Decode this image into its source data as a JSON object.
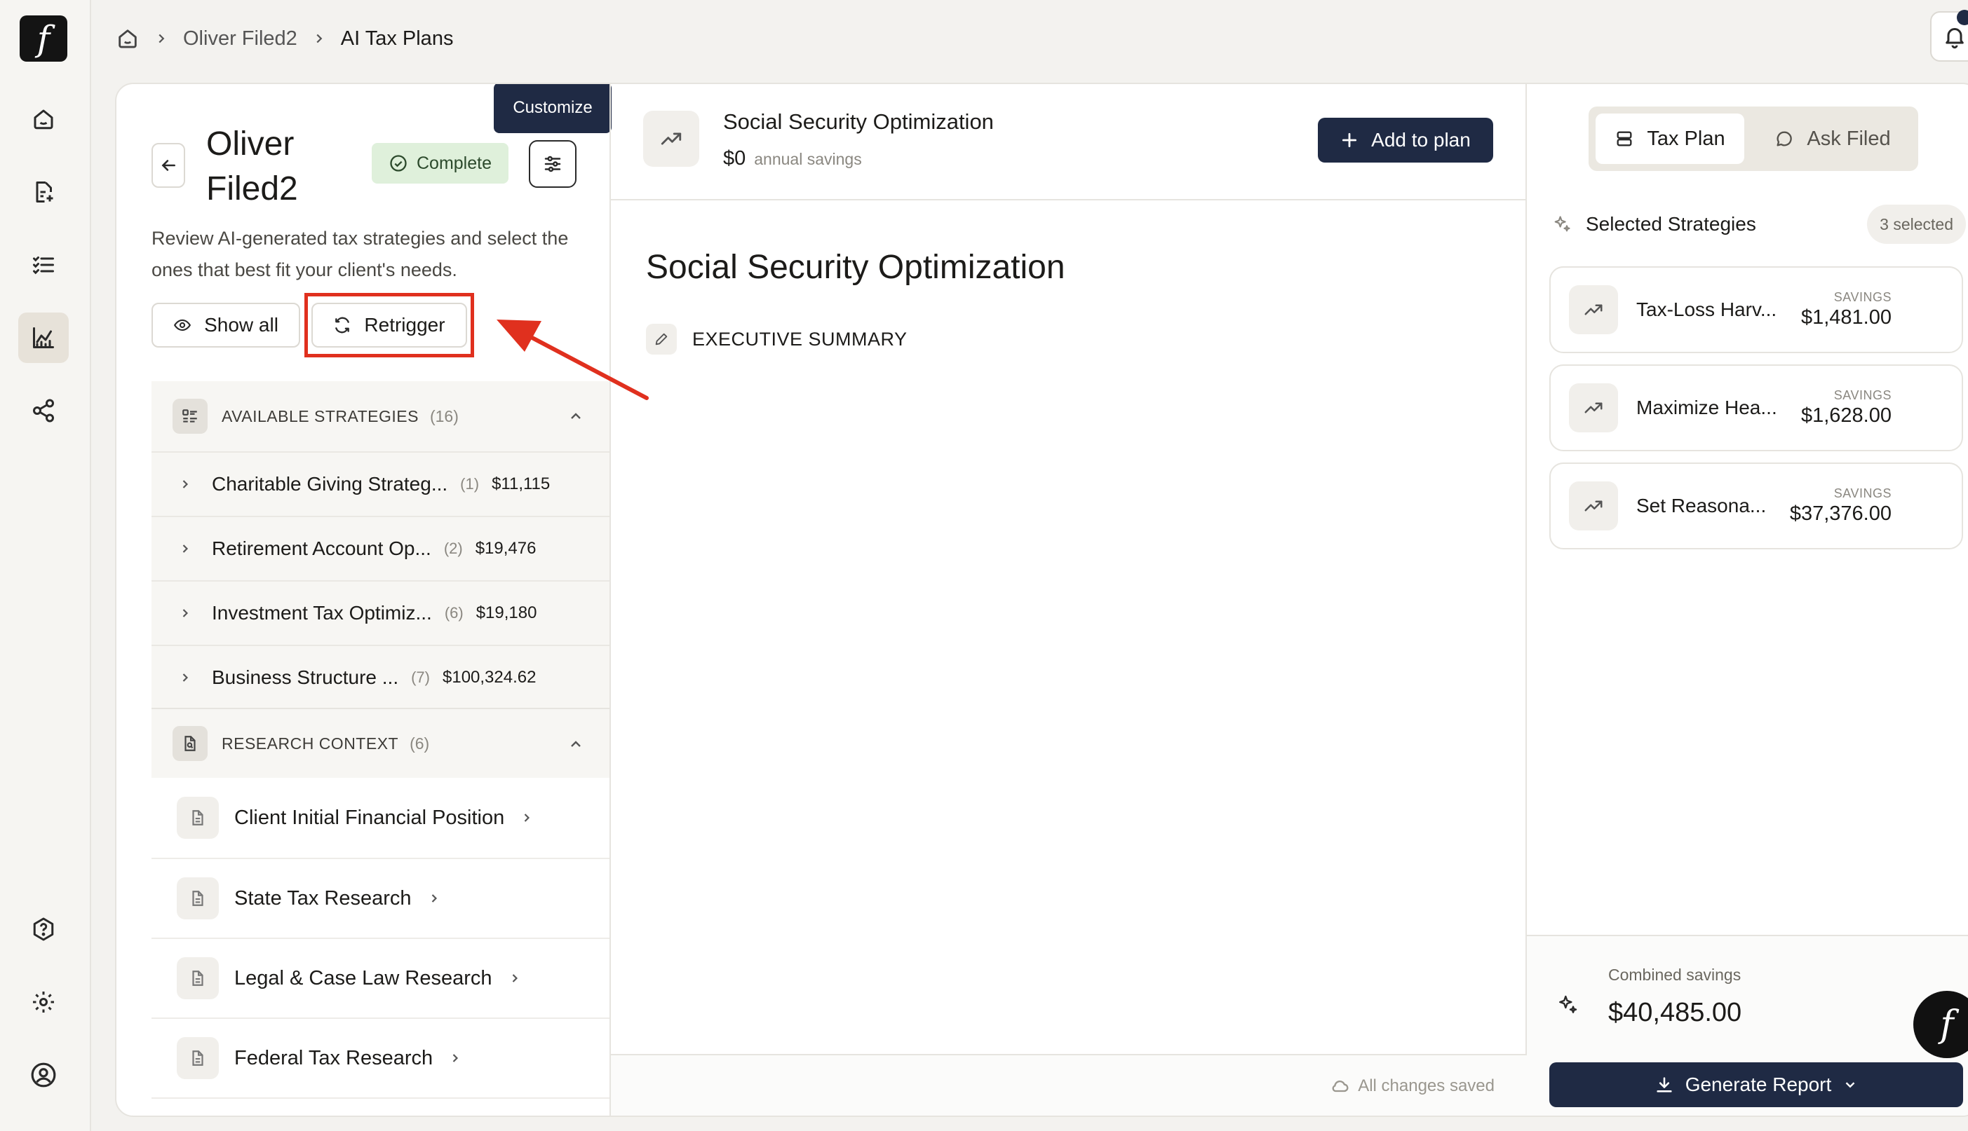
{
  "app": {
    "logo_glyph": "f",
    "nav": [
      {
        "name": "home",
        "icon": "home-icon"
      },
      {
        "name": "documents",
        "icon": "document-sparkle-icon"
      },
      {
        "name": "checklist",
        "icon": "checklist-icon"
      },
      {
        "name": "tax-plans",
        "icon": "chart-icon",
        "active": true
      },
      {
        "name": "share",
        "icon": "share-icon"
      },
      {
        "name": "help",
        "icon": "help-icon"
      },
      {
        "name": "settings",
        "icon": "gear-icon"
      },
      {
        "name": "account",
        "icon": "user-icon"
      }
    ]
  },
  "breadcrumb": {
    "items": [
      "Oliver Filed2",
      "AI Tax Plans"
    ]
  },
  "left": {
    "tooltip": "Customize",
    "client_name": "Oliver Filed2",
    "status": "Complete",
    "description": "Review AI-generated tax strategies and select the ones that best fit your client's needs.",
    "show_all_label": "Show all",
    "retrigger_label": "Retrigger",
    "available": {
      "title": "AVAILABLE STRATEGIES",
      "count": "(16)",
      "items": [
        {
          "name": "Charitable Giving Strateg...",
          "count": "(1)",
          "amount": "$11,115"
        },
        {
          "name": "Retirement Account Op...",
          "count": "(2)",
          "amount": "$19,476"
        },
        {
          "name": "Investment Tax Optimiz...",
          "count": "(6)",
          "amount": "$19,180"
        },
        {
          "name": "Business Structure ...",
          "count": "(7)",
          "amount": "$100,324.62"
        }
      ]
    },
    "research": {
      "title": "RESEARCH CONTEXT",
      "count": "(6)",
      "items": [
        {
          "name": "Client Initial Financial Position"
        },
        {
          "name": "State Tax Research"
        },
        {
          "name": "Legal & Case Law Research"
        },
        {
          "name": "Federal Tax Research"
        }
      ]
    }
  },
  "middle": {
    "title": "Social Security Optimization",
    "savings_value": "$0",
    "savings_label": "annual savings",
    "add_label": "Add to plan",
    "doc_title": "Social Security Optimization",
    "section_label": "EXECUTIVE SUMMARY",
    "saved_status": "All changes saved"
  },
  "right": {
    "tabs": [
      {
        "label": "Tax Plan",
        "active": true
      },
      {
        "label": "Ask Filed",
        "active": false
      }
    ],
    "selected_title": "Selected Strategies",
    "selected_count": "3 selected",
    "savings_label": "SAVINGS",
    "strategies": [
      {
        "name": "Tax-Loss Harv...",
        "savings": "$1,481.00"
      },
      {
        "name": "Maximize Hea...",
        "savings": "$1,628.00"
      },
      {
        "name": "Set Reasona...",
        "savings": "$37,376.00"
      }
    ],
    "combined_label": "Combined savings",
    "combined_value": "$40,485.00",
    "generate_label": "Generate Report"
  },
  "colors": {
    "primary": "#1f2a44",
    "highlight": "#e0301e",
    "complete_bg": "#dff0db"
  }
}
